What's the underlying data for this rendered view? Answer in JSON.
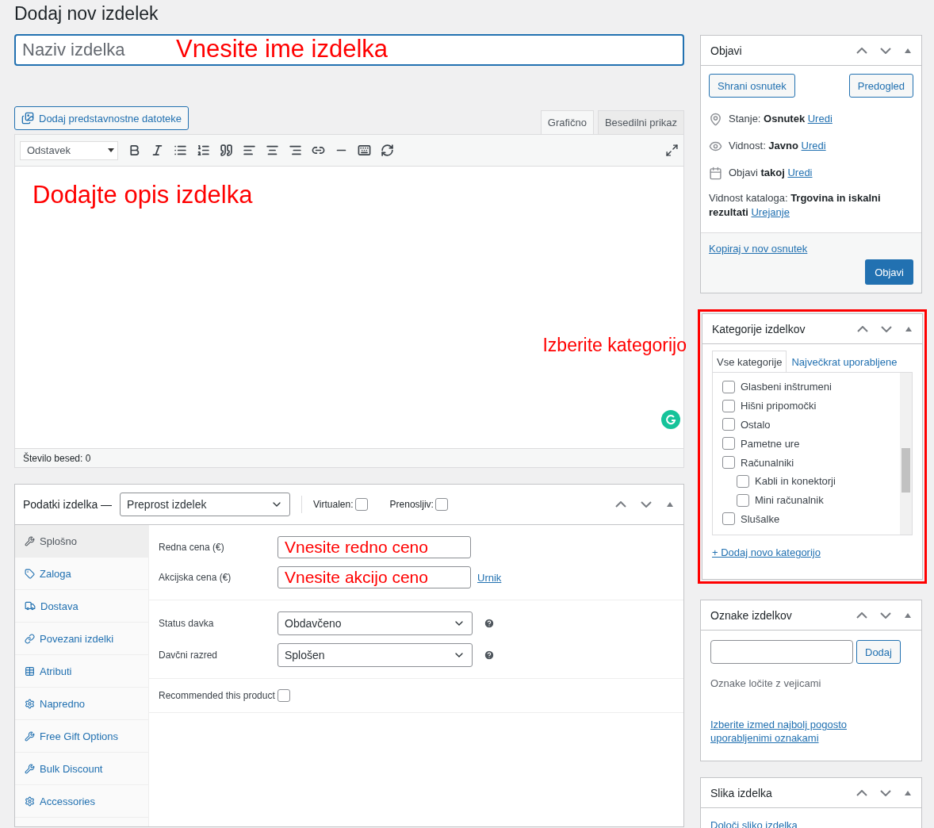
{
  "page_title": "Dodaj nov izdelek",
  "title_field": {
    "placeholder": "Naziv izdelka",
    "annotation": "Vnesite ime izdelka"
  },
  "media_button": "Dodaj predstavnostne datoteke",
  "editor": {
    "tabs": [
      {
        "label": "Grafično",
        "selected": true
      },
      {
        "label": "Besedilni prikaz",
        "selected": false
      }
    ],
    "format_select": "Odstavek",
    "annotation": "Dodajte opis izdelka",
    "side_annotation": "Izberite kategorijo",
    "word_count": "Število besed: 0"
  },
  "product_data": {
    "title": "Podatki izdelka —",
    "type_select": "Preprost izdelek",
    "options": [
      {
        "label": "Virtualen:",
        "checked": false
      },
      {
        "label": "Prenosljiv:",
        "checked": false
      }
    ],
    "tabs": [
      {
        "label": "Splošno",
        "kind": "wrench",
        "selected": true
      },
      {
        "label": "Zaloga",
        "kind": "tag",
        "selected": false
      },
      {
        "label": "Dostava",
        "kind": "truck",
        "selected": false
      },
      {
        "label": "Povezani izdelki",
        "kind": "link",
        "selected": false
      },
      {
        "label": "Atributi",
        "kind": "table",
        "selected": false
      },
      {
        "label": "Napredno",
        "kind": "gear",
        "selected": false
      },
      {
        "label": "Free Gift Options",
        "kind": "wrench",
        "selected": false
      },
      {
        "label": "Bulk Discount",
        "kind": "wrench",
        "selected": false
      },
      {
        "label": "Accessories",
        "kind": "gear",
        "selected": false
      }
    ],
    "groups": [
      {
        "fields": [
          {
            "kind": "input",
            "label": "Redna cena (€)",
            "annotation": "Vnesite redno ceno"
          },
          {
            "kind": "input",
            "label": "Akcijska cena (€)",
            "annotation": "Vnesite akcijo ceno",
            "link": "Urnik"
          }
        ]
      },
      {
        "fields": [
          {
            "kind": "select",
            "label": "Status davka",
            "value": "Obdavčeno"
          },
          {
            "kind": "select",
            "label": "Davčni razred",
            "value": "Splošen"
          }
        ]
      },
      {
        "fields": [
          {
            "kind": "checkbox",
            "label": "Recommended this product",
            "checked": false
          }
        ]
      }
    ]
  },
  "sidebar": {
    "publish": {
      "title": "Objavi",
      "buttons": [
        "Shrani osnutek",
        "Predogled"
      ],
      "rows": [
        {
          "kind": "pin",
          "text": "Stanje: **Osnutek**",
          "link": "Uredi"
        },
        {
          "kind": "eye",
          "text": "Vidnost: **Javno**",
          "link": "Uredi"
        },
        {
          "kind": "calendar",
          "text": "Objavi **takoj**",
          "link": "Uredi"
        },
        {
          "kind": "plain",
          "text": "Vidnost kataloga: **Trgovina in iskalni rezultati**",
          "link": "Urejanje"
        }
      ],
      "copy_link": "Kopiraj v nov osnutek",
      "publish_button": "Objavi"
    },
    "categories": {
      "title": "Kategorije izdelkov",
      "highlighted": true,
      "tabs": [
        {
          "label": "Vse kategorije",
          "selected": true
        },
        {
          "label": "Največkrat uporabljene",
          "selected": false
        }
      ],
      "items": [
        {
          "label": "Glasbeni inštrumeni",
          "checked": false
        },
        {
          "label": "Hišni pripomočki",
          "checked": false
        },
        {
          "label": "Ostalo",
          "checked": false
        },
        {
          "label": "Pametne ure",
          "checked": false
        },
        {
          "label": "Računalniki",
          "checked": false,
          "children": [
            {
              "label": "Kabli in konektorji",
              "checked": false
            },
            {
              "label": "Mini računalnik",
              "checked": false
            }
          ]
        },
        {
          "label": "Slušalke",
          "checked": false
        }
      ],
      "add_link": "+ Dodaj novo kategorijo"
    },
    "tags": {
      "title": "Oznake izdelkov",
      "add_button": "Dodaj",
      "hint": "Oznake ločite z vejicami",
      "link": "Izberite izmed najbolj pogosto uporabljenimi oznakami"
    },
    "image": {
      "title": "Slika izdelka",
      "link": "Določi sliko izdelka"
    }
  }
}
